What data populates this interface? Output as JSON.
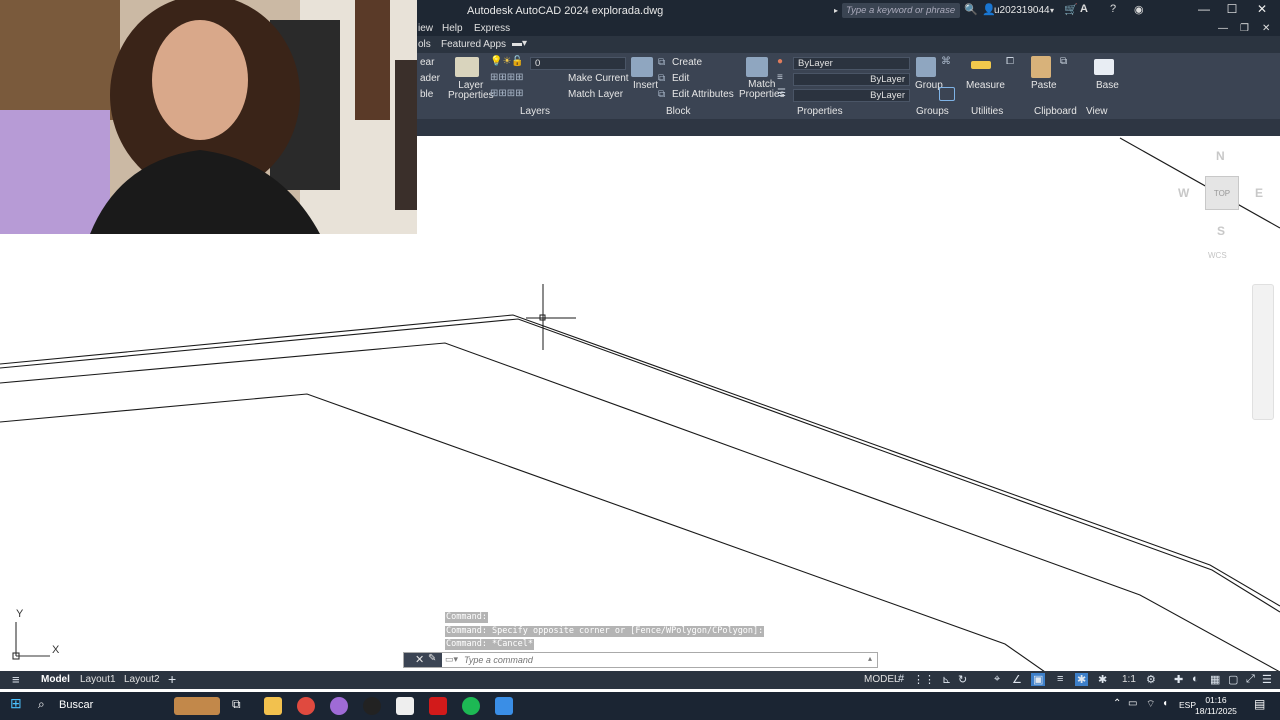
{
  "window": {
    "title": "Autodesk AutoCAD 2024  explorada.dwg",
    "search_placeholder": "Type a keyword or phrase",
    "user": "u202319044"
  },
  "menubar": {
    "items": [
      "iew",
      "Help",
      "Express"
    ],
    "tabs": [
      "ols",
      "Featured Apps"
    ]
  },
  "ribbon": {
    "left_partial": [
      "ear",
      "ader",
      "ble"
    ],
    "layers": {
      "panel_title": "Layers",
      "layer_properties": "Layer\nProperties",
      "current_layer": "0",
      "make_current": "Make Current",
      "match_layer": "Match Layer"
    },
    "block": {
      "panel_title": "Block",
      "insert": "Insert",
      "create": "Create",
      "edit": "Edit",
      "edit_attributes": "Edit Attributes"
    },
    "properties": {
      "panel_title": "Properties",
      "match_properties": "Match\nProperties",
      "color": "ByLayer",
      "linetype": "ByLayer",
      "lineweight": "ByLayer"
    },
    "groups": {
      "panel_title": "Groups",
      "group": "Group"
    },
    "utilities": {
      "panel_title": "Utilities",
      "measure": "Measure"
    },
    "clipboard": {
      "panel_title": "Clipboard",
      "paste": "Paste"
    },
    "view": {
      "panel_title": "View",
      "base": "Base"
    }
  },
  "viewcube": {
    "north": "N",
    "south": "S",
    "east": "E",
    "west": "W",
    "face": "TOP",
    "wcs": "WCS"
  },
  "ucs": {
    "x": "X",
    "y": "Y"
  },
  "command": {
    "history": [
      "Command:",
      "Command: Specify opposite corner or [Fence/WPolygon/CPolygon]:",
      "Command: *Cancel*"
    ],
    "placeholder": "Type a command"
  },
  "layout_tabs": [
    "Model",
    "Layout1",
    "Layout2"
  ],
  "status": {
    "model": "MODEL",
    "scale": "1:1"
  },
  "taskbar": {
    "search": "Buscar",
    "lang": "ESP",
    "time": "01:16",
    "date": "18/11/2025"
  }
}
